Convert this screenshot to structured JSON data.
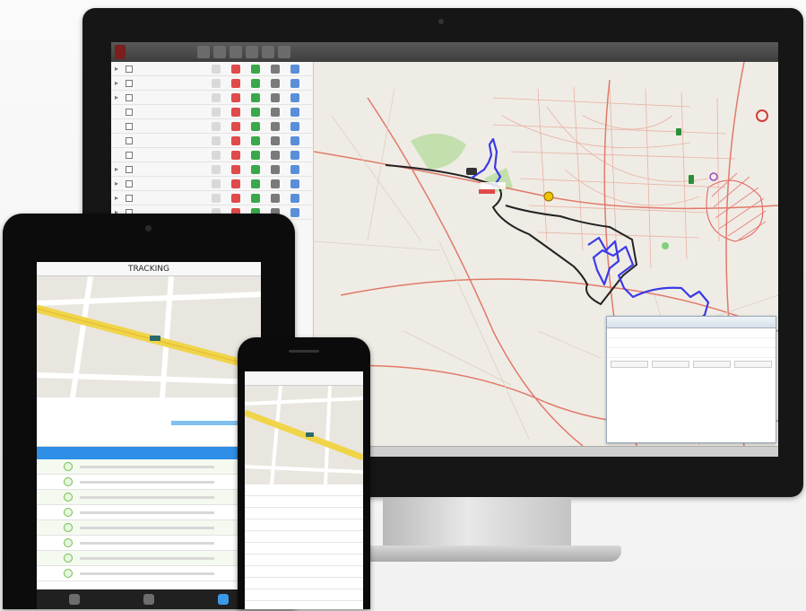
{
  "desktop": {
    "topbar": {
      "brand": ""
    },
    "vehicles": [
      {
        "name": "",
        "type": "group"
      },
      {
        "name": "",
        "type": "group"
      },
      {
        "name": "",
        "type": "group"
      },
      {
        "name": "",
        "type": "item"
      },
      {
        "name": "",
        "type": "item"
      },
      {
        "name": "",
        "type": "item"
      },
      {
        "name": "",
        "type": "item"
      },
      {
        "name": "",
        "type": "group"
      },
      {
        "name": "",
        "type": "group"
      },
      {
        "name": "",
        "type": "group"
      },
      {
        "name": "",
        "type": "group"
      }
    ],
    "popup": {
      "title": "",
      "lines": [
        "",
        "",
        ""
      ],
      "stats": [
        "",
        "",
        "",
        ""
      ]
    },
    "colors": {
      "route_blue": "#3a3ae8",
      "route_black": "#222222",
      "map_bg": "#efece5",
      "roads": "#e8a89a",
      "park": "#b8dca0",
      "hatched_zone": "#e45a5a"
    }
  },
  "tablet": {
    "nav_title": "TRACKING",
    "back_label": "",
    "vehicle": {
      "title": "",
      "subtitle": ""
    },
    "blue_header": "",
    "rows": [
      {
        "time": ""
      },
      {
        "time": ""
      },
      {
        "time": ""
      },
      {
        "time": ""
      },
      {
        "time": ""
      },
      {
        "time": ""
      },
      {
        "time": ""
      },
      {
        "time": ""
      }
    ],
    "tabs": [
      "list-tab",
      "map-tab",
      "tracking-tab"
    ]
  },
  "phone": {
    "nav_title": "",
    "back_label": "",
    "rows": [
      {
        "key": "",
        "value": ""
      },
      {
        "key": "",
        "value": ""
      },
      {
        "key": "",
        "value": ""
      },
      {
        "key": "",
        "value": ""
      },
      {
        "key": "",
        "value": ""
      },
      {
        "key": "",
        "value": ""
      },
      {
        "key": "",
        "value": ""
      },
      {
        "key": "",
        "value": ""
      },
      {
        "key": "",
        "value": ""
      },
      {
        "key": "",
        "value": ""
      }
    ]
  }
}
